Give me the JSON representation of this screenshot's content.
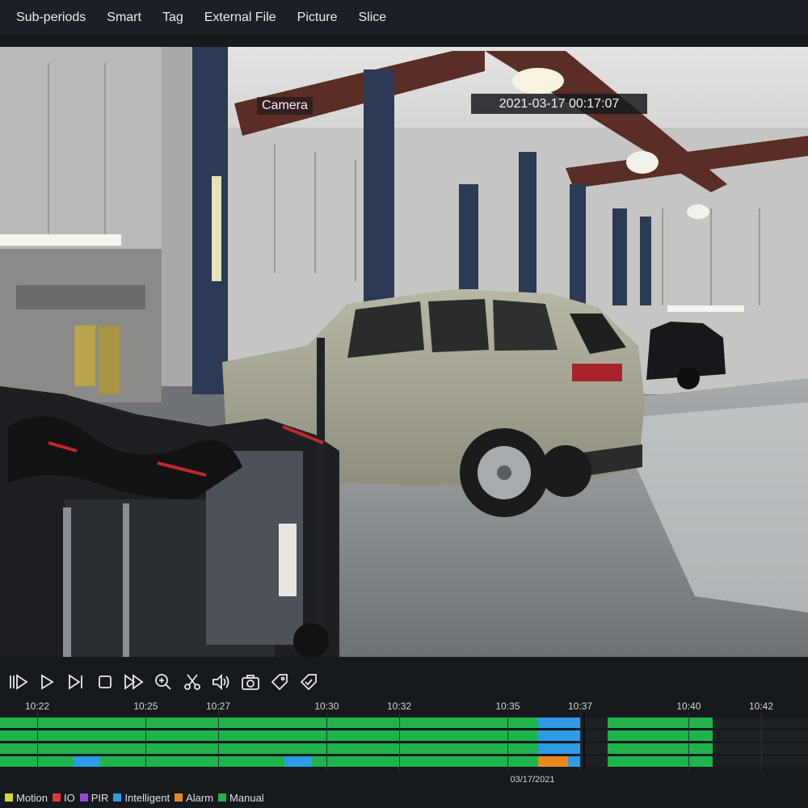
{
  "menu": {
    "items": [
      {
        "label": "Sub-periods"
      },
      {
        "label": "Smart"
      },
      {
        "label": "Tag"
      },
      {
        "label": "External File"
      },
      {
        "label": "Picture"
      },
      {
        "label": "Slice"
      }
    ]
  },
  "video": {
    "camera_name": "Camera",
    "timestamp": "2021-03-17 00:17:07"
  },
  "controls": [
    {
      "icon": "step-back-icon"
    },
    {
      "icon": "play-icon"
    },
    {
      "icon": "step-forward-icon"
    },
    {
      "icon": "stop-icon"
    },
    {
      "icon": "fast-forward-icon"
    },
    {
      "icon": "zoom-in-icon"
    },
    {
      "icon": "clip-icon"
    },
    {
      "icon": "volume-icon"
    },
    {
      "icon": "snapshot-icon"
    },
    {
      "icon": "tag-icon"
    },
    {
      "icon": "tag-edit-icon"
    }
  ],
  "timeline": {
    "ticks": [
      "10:22",
      "10:25",
      "10:27",
      "10:30",
      "10:32",
      "10:35",
      "10:37",
      "10:40",
      "10:42"
    ],
    "date": "03/17/2021",
    "colors": {
      "manual": "#1fb34c",
      "intelligent": "#2f9be4",
      "alarm": "#e58a1f",
      "track_bg": "#1d2126"
    },
    "tracks": [
      [
        {
          "type": "manual",
          "start": "10:20:00",
          "end": "10:35:50"
        },
        {
          "type": "intelligent",
          "start": "10:35:50",
          "end": "10:37:00"
        },
        {
          "type": "manual",
          "start": "10:37:45",
          "end": "10:40:40"
        }
      ],
      [
        {
          "type": "manual",
          "start": "10:20:00",
          "end": "10:35:50"
        },
        {
          "type": "intelligent",
          "start": "10:35:50",
          "end": "10:37:00"
        },
        {
          "type": "manual",
          "start": "10:37:45",
          "end": "10:40:40"
        }
      ],
      [
        {
          "type": "manual",
          "start": "10:20:00",
          "end": "10:35:50"
        },
        {
          "type": "intelligent",
          "start": "10:35:50",
          "end": "10:37:00"
        },
        {
          "type": "manual",
          "start": "10:37:45",
          "end": "10:40:40"
        }
      ],
      [
        {
          "type": "manual",
          "start": "10:20:00",
          "end": "10:23:00"
        },
        {
          "type": "intelligent",
          "start": "10:23:00",
          "end": "10:23:45"
        },
        {
          "type": "manual",
          "start": "10:23:45",
          "end": "10:28:50"
        },
        {
          "type": "intelligent",
          "start": "10:28:50",
          "end": "10:29:35"
        },
        {
          "type": "manual",
          "start": "10:29:35",
          "end": "10:35:50"
        },
        {
          "type": "alarm",
          "start": "10:35:50",
          "end": "10:36:40"
        },
        {
          "type": "intelligent",
          "start": "10:36:40",
          "end": "10:37:00"
        },
        {
          "type": "manual",
          "start": "10:37:45",
          "end": "10:40:40"
        }
      ]
    ]
  },
  "legend": [
    {
      "label": "Motion",
      "color": "#d8d43a"
    },
    {
      "label": "IO",
      "color": "#e23b2e"
    },
    {
      "label": "PIR",
      "color": "#9a44e0"
    },
    {
      "label": "Intelligent",
      "color": "#2f9be4"
    },
    {
      "label": "Alarm",
      "color": "#e58a1f"
    },
    {
      "label": "Manual",
      "color": "#1fb34c"
    }
  ]
}
